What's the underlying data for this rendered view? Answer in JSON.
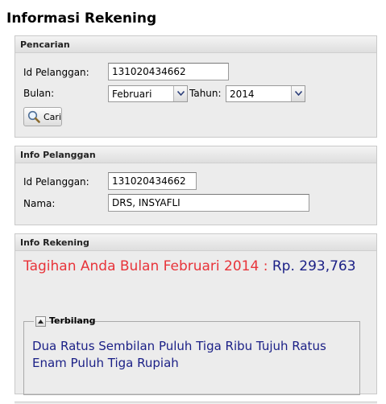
{
  "page": {
    "title": "Informasi Rekening"
  },
  "search": {
    "header": "Pencarian",
    "id_label": "Id Pelanggan:",
    "id_value": "131020434662",
    "month_label": "Bulan:",
    "month_value": "Februari",
    "year_label": "Tahun:",
    "year_value": "2014",
    "search_button": "Cari",
    "search_icon": "magnifier-icon"
  },
  "customer": {
    "header": "Info Pelanggan",
    "id_label": "Id Pelanggan:",
    "id_value": "131020434662",
    "name_label": "Nama:",
    "name_value": "DRS, INSYAFLI"
  },
  "account": {
    "header": "Info Rekening",
    "bill_prefix": "Tagihan Anda Bulan Februari 2014 :",
    "bill_amount": "Rp. 293,763",
    "spelled_legend": "Terbilang",
    "spelled_text": "Dua Ratus Sembilan Puluh Tiga Ribu Tujuh Ratus Enam Puluh Tiga Rupiah"
  },
  "colors": {
    "bill_prefix": "#e8343a",
    "bill_amount": "#1a1f86",
    "panel_bg": "#ececec"
  }
}
